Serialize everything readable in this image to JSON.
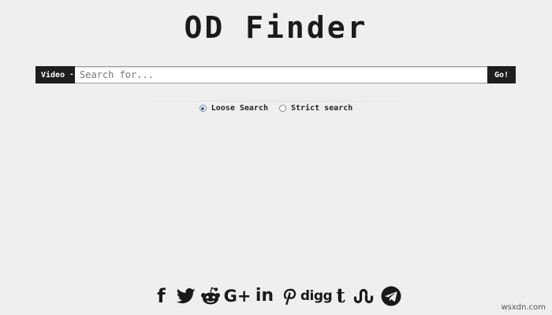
{
  "header": {
    "title": "OD Finder"
  },
  "search": {
    "category_label": "Video",
    "category_caret": "-",
    "placeholder": "Search for...",
    "value": "",
    "go_label": "Go!"
  },
  "modes": {
    "loose_label": "Loose Search",
    "strict_label": "Strict search",
    "selected": "loose"
  },
  "social": {
    "icons": [
      "facebook-icon",
      "twitter-icon",
      "reddit-icon",
      "google-plus-icon",
      "linkedin-icon",
      "pinterest-icon",
      "digg-icon",
      "tumblr-icon",
      "stumbleupon-icon",
      "telegram-icon"
    ],
    "digg_text": "digg",
    "tumblr_text": "t",
    "gplus_text": "G+",
    "linkedin_text": "in",
    "facebook_text": "f"
  },
  "watermark": "wsxdn.com",
  "colors": {
    "background": "#efefef",
    "dark": "#1e1e1e",
    "radio_selected": "#2a6ad0"
  }
}
